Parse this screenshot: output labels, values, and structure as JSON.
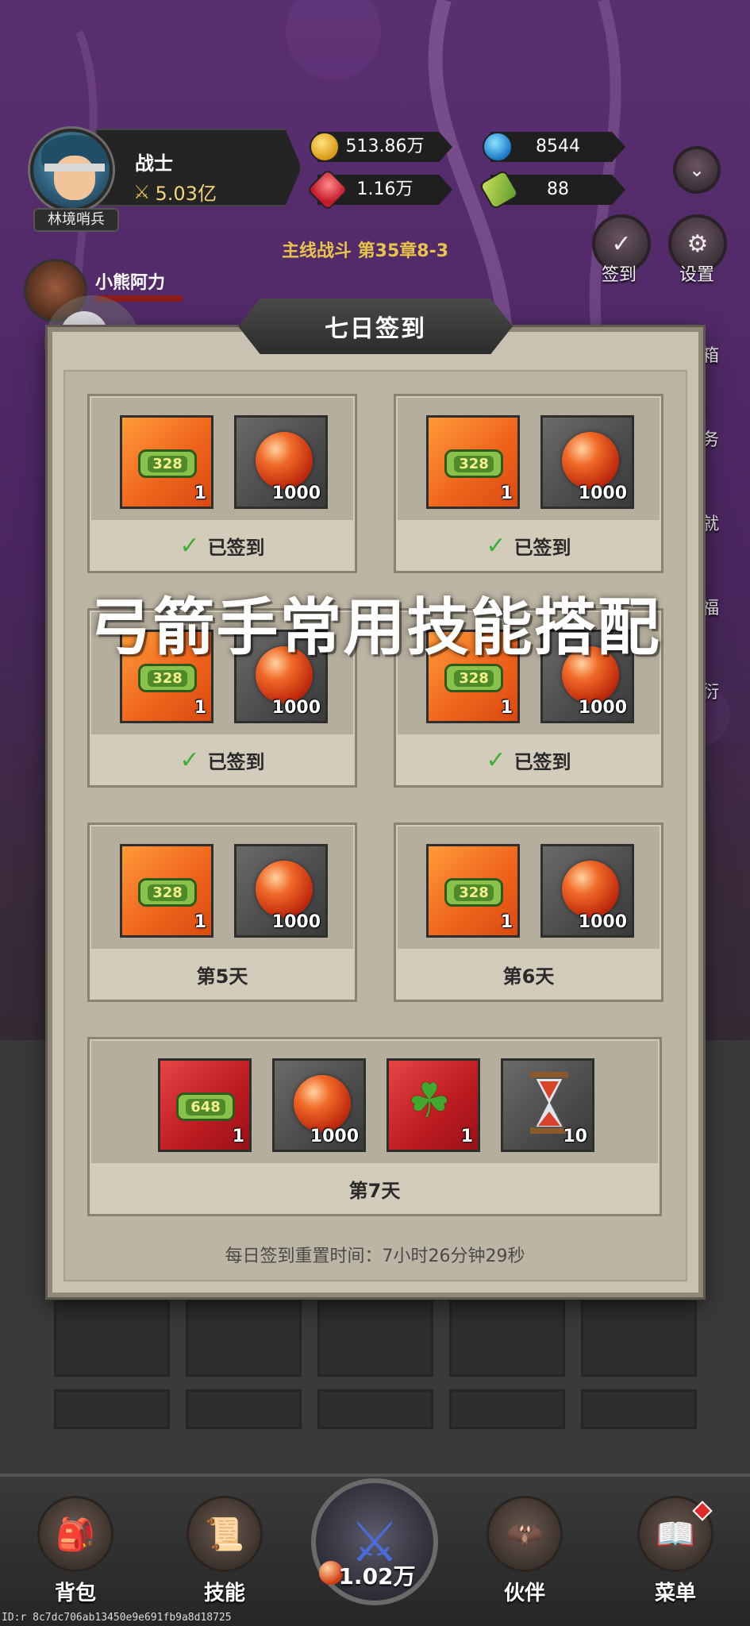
{
  "hud": {
    "class_name": "战士",
    "power": "5.03亿",
    "rank": "林境哨兵",
    "gold": "513.86万",
    "gems": "1.16万",
    "blue_currency": "8544",
    "tickets": "88"
  },
  "side_buttons": {
    "signin": "签到",
    "settings": "设置",
    "partial_1": "箱",
    "partial_2": "务",
    "partial_3": "就",
    "partial_4": "福",
    "partial_5": "衍"
  },
  "stage": {
    "title": "主线战斗 第35章8-3"
  },
  "companion": {
    "name": "小熊阿力"
  },
  "modal": {
    "title": "七日签到",
    "days": [
      {
        "ticket": "328",
        "ticket_qty": "1",
        "orb_qty": "1000",
        "status": "已签到"
      },
      {
        "ticket": "328",
        "ticket_qty": "1",
        "orb_qty": "1000",
        "status": "已签到"
      },
      {
        "ticket": "328",
        "ticket_qty": "1",
        "orb_qty": "1000",
        "status": "已签到"
      },
      {
        "ticket": "328",
        "ticket_qty": "1",
        "orb_qty": "1000",
        "status": "已签到"
      },
      {
        "ticket": "328",
        "ticket_qty": "1",
        "orb_qty": "1000",
        "status": "第5天"
      },
      {
        "ticket": "328",
        "ticket_qty": "1",
        "orb_qty": "1000",
        "status": "第6天"
      }
    ],
    "day7": {
      "ticket": "648",
      "ticket_qty": "1",
      "orb_qty": "1000",
      "clover_qty": "1",
      "hourglass_qty": "10",
      "label": "第7天"
    },
    "reset_text": "每日签到重置时间：7小时26分钟29秒"
  },
  "overlay_caption": "弓箭手常用技能搭配",
  "bottom_nav": {
    "bag": "背包",
    "skills": "技能",
    "battle_value": "1.02万",
    "partners": "伙伴",
    "menu": "菜单"
  },
  "debug_id": "ID:r 8c7dc706ab13450e9e691fb9a8d18725",
  "colors": {
    "accent_gold": "#e8c54a",
    "check_green": "#3fae36",
    "notif_red": "#e02a2a"
  }
}
